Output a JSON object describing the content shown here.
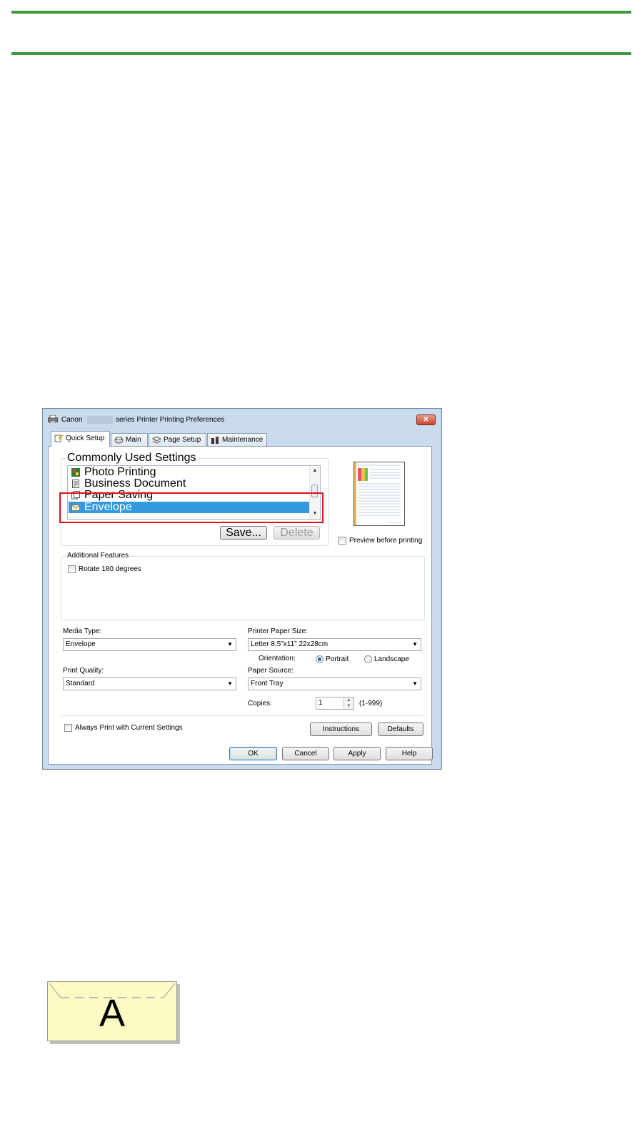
{
  "dialog": {
    "title_prefix": "Canon",
    "title_suffix": "series Printer Printing Preferences",
    "close_glyph": "✕",
    "tabs": [
      {
        "label": "Quick Setup",
        "icon": "quick-setup-icon",
        "active": true
      },
      {
        "label": "Main",
        "icon": "main-icon"
      },
      {
        "label": "Page Setup",
        "icon": "page-setup-icon"
      },
      {
        "label": "Maintenance",
        "icon": "maintenance-icon"
      }
    ],
    "commonly_used": {
      "label": "Commonly Used Settings",
      "items": [
        {
          "label": "Photo Printing",
          "icon": "photo-printing-icon"
        },
        {
          "label": "Business Document",
          "icon": "business-document-icon"
        },
        {
          "label": "Paper Saving",
          "icon": "paper-saving-icon"
        },
        {
          "label": "Envelope",
          "icon": "envelope-icon",
          "selected": true
        }
      ],
      "save_label": "Save...",
      "delete_label": "Delete"
    },
    "preview": {
      "label": "Preview before printing",
      "checked": false
    },
    "additional_features": {
      "label": "Additional Features",
      "rotate_label": "Rotate 180 degrees",
      "rotate_checked": false
    },
    "media_type": {
      "label": "Media Type:",
      "value": "Envelope"
    },
    "printer_paper_size": {
      "label": "Printer Paper Size:",
      "value": "Letter 8.5\"x11\" 22x28cm"
    },
    "orientation": {
      "label": "Orientation:",
      "portrait": "Portrait",
      "landscape": "Landscape",
      "selected": "Portrait"
    },
    "print_quality": {
      "label": "Print Quality:",
      "value": "Standard"
    },
    "paper_source": {
      "label": "Paper Source:",
      "value": "Front Tray"
    },
    "copies": {
      "label": "Copies:",
      "value": "1",
      "range": "(1-999)"
    },
    "always_print": {
      "label": "Always Print with Current Settings",
      "checked": false
    },
    "buttons": {
      "instructions": "Instructions",
      "defaults": "Defaults",
      "ok": "OK",
      "cancel": "Cancel",
      "apply": "Apply",
      "help": "Help"
    }
  },
  "envelope_illustration": {
    "letter": "A"
  },
  "colors": {
    "rule": "#3c9a3c",
    "highlight": "#e0131b",
    "selection": "#3399e0",
    "envelope": "#fcfbc4"
  }
}
